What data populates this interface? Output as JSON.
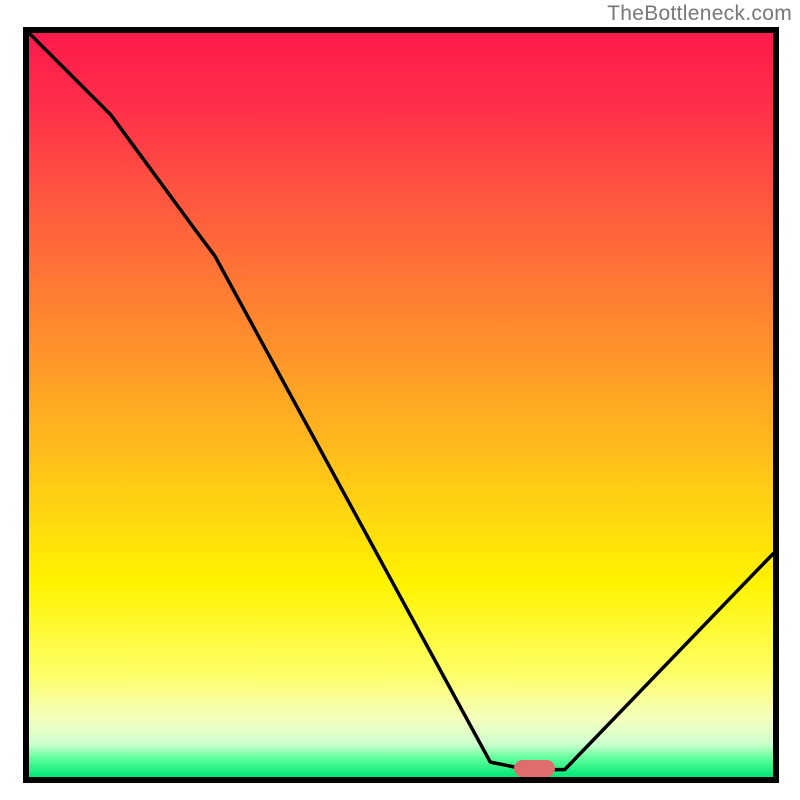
{
  "watermark": "TheBottleneck.com",
  "colors": {
    "border": "#000000",
    "curve": "#000000",
    "marker": "#e06d6d",
    "gradient_stops": [
      {
        "offset": 0.0,
        "color": "#ff1a4b"
      },
      {
        "offset": 0.1,
        "color": "#ff2f49"
      },
      {
        "offset": 0.22,
        "color": "#ff5640"
      },
      {
        "offset": 0.4,
        "color": "#ff8b2e"
      },
      {
        "offset": 0.58,
        "color": "#ffc21a"
      },
      {
        "offset": 0.74,
        "color": "#fff300"
      },
      {
        "offset": 0.86,
        "color": "#feff66"
      },
      {
        "offset": 0.92,
        "color": "#f6ffbc"
      },
      {
        "offset": 0.955,
        "color": "#cfffcf"
      },
      {
        "offset": 0.975,
        "color": "#60ff9b"
      },
      {
        "offset": 1.0,
        "color": "#00e676"
      }
    ]
  },
  "chart_data": {
    "type": "line",
    "title": "",
    "xlabel": "",
    "ylabel": "",
    "xlim": [
      0,
      100
    ],
    "ylim": [
      0,
      100
    ],
    "grid": false,
    "series": [
      {
        "name": "bottleneck-curve",
        "x": [
          0,
          11,
          22,
          25,
          62,
          67,
          72,
          100
        ],
        "values": [
          100,
          89,
          74,
          70,
          2,
          1,
          1,
          30
        ]
      }
    ],
    "annotations": [
      {
        "name": "optimal-marker",
        "x": 68,
        "y": 0,
        "width_pct": 5.5,
        "height_pct": 2.3
      }
    ]
  }
}
